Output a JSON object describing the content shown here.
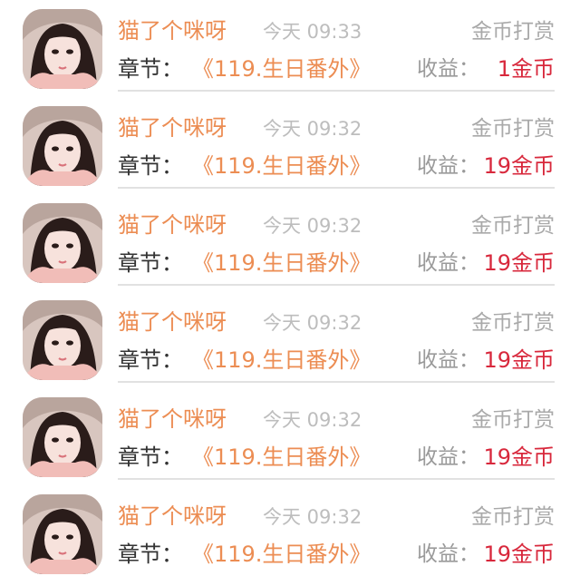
{
  "rows": [
    {
      "name": "猫了个咪呀",
      "time": "今天 09:33",
      "type": "金币打赏",
      "chapter_label": "章节：",
      "chapter_title": "《119.生日番外》",
      "earnings_label": "收益：",
      "earnings_value": "1金币"
    },
    {
      "name": "猫了个咪呀",
      "time": "今天 09:32",
      "type": "金币打赏",
      "chapter_label": "章节：",
      "chapter_title": "《119.生日番外》",
      "earnings_label": "收益：",
      "earnings_value": "19金币"
    },
    {
      "name": "猫了个咪呀",
      "time": "今天 09:32",
      "type": "金币打赏",
      "chapter_label": "章节：",
      "chapter_title": "《119.生日番外》",
      "earnings_label": "收益：",
      "earnings_value": "19金币"
    },
    {
      "name": "猫了个咪呀",
      "time": "今天 09:32",
      "type": "金币打赏",
      "chapter_label": "章节：",
      "chapter_title": "《119.生日番外》",
      "earnings_label": "收益：",
      "earnings_value": "19金币"
    },
    {
      "name": "猫了个咪呀",
      "time": "今天 09:32",
      "type": "金币打赏",
      "chapter_label": "章节：",
      "chapter_title": "《119.生日番外》",
      "earnings_label": "收益：",
      "earnings_value": "19金币"
    },
    {
      "name": "猫了个咪呀",
      "time": "今天 09:32",
      "type": "金币打赏",
      "chapter_label": "章节：",
      "chapter_title": "《119.生日番外》",
      "earnings_label": "收益：",
      "earnings_value": "19金币"
    }
  ],
  "colors": {
    "name": "#ec8d53",
    "time": "#bdbdbd",
    "type": "#a9a9a9",
    "chapter_title": "#ec8d53",
    "earnings_value": "#d8283c",
    "divider": "#e1e1e1"
  },
  "icons": {
    "avatar": "user-avatar-photo"
  }
}
